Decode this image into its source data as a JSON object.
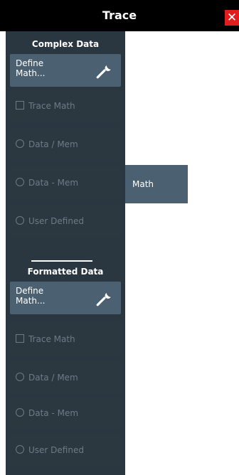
{
  "window": {
    "title": "Trace",
    "close_icon": "close-icon",
    "close_color": "#e11d1d"
  },
  "tab": {
    "label": "Math"
  },
  "complex": {
    "title": "Complex Data",
    "define_label": "Define\nMath...",
    "trace_math": "Trace Math",
    "data_div_mem": "Data / Mem",
    "data_minus_mem": "Data - Mem",
    "user_defined": "User Defined"
  },
  "formatted": {
    "title": "Formatted Data",
    "define_label": "Define\nMath...",
    "trace_math": "Trace Math",
    "data_div_mem": "Data / Mem",
    "data_minus_mem": "Data - Mem",
    "user_defined": "User Defined"
  },
  "colors": {
    "panel": "#2a3640",
    "button_active": "#4b6070",
    "disabled_text": "#6d7b86",
    "title_bar": "#000000"
  },
  "icons": {
    "wrench": "wrench-icon",
    "checkbox": "checkbox-icon",
    "radio": "radio-icon"
  }
}
